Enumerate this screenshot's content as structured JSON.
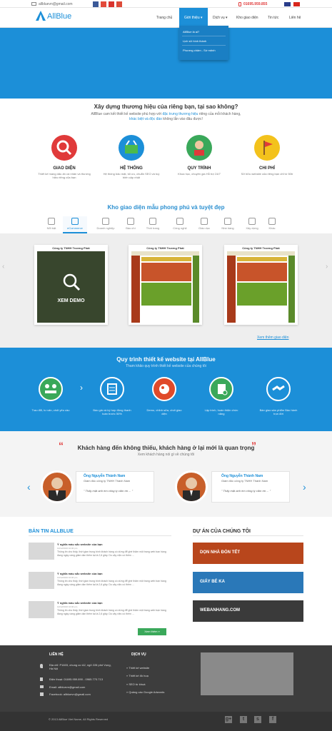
{
  "topbar": {
    "email": "allbluevn@gmail.com",
    "phone": "01695.959.855",
    "social": [
      "f",
      "t",
      "yt",
      "g+"
    ]
  },
  "nav": {
    "logo": "AllBlue",
    "items": [
      "Trang chủ",
      "Giới thiệu ▾",
      "Dịch vụ ▾",
      "Kho giao diện",
      "Tin tức",
      "Liên hệ"
    ],
    "active": 1,
    "dropdown": [
      "AllBlue là ai?",
      "Lịch sử hình thành",
      "Phương châm - Sứ mệnh"
    ]
  },
  "intro": {
    "title": "Xây dựng thương hiệu của riêng bạn, tại sao không?",
    "line1a": "AllBlue cam kết thiết kế website phù hợp với ",
    "line1b": "đặc trưng thương hiệu",
    "line1c": " riêng của mỗi khách hàng,",
    "line2a": "khác biệt và độc đáo",
    "line2b": " không lẫn vào đâu được!"
  },
  "features": [
    {
      "title": "GIAO DIỆN",
      "desc": "Thiết kế mang dấu ấn cá nhân và thương hiệu riêng của bạn",
      "color": "#e03a3a"
    },
    {
      "title": "HỆ THỐNG",
      "desc": "Hệ thống bảo mật, tối ưu, chuẩn SEO và tuỳ biến cập nhật",
      "color": "#1c8fd8"
    },
    {
      "title": "QUY TRÌNH",
      "desc": "Khoa học, chuyên gia Hỗ trợ 24/7",
      "color": "#3aa85a"
    },
    {
      "title": "CHI PHÍ",
      "desc": "Sở hữu website của riêng bạn chỉ từ 50tr",
      "color": "#f3c21c"
    }
  ],
  "gallery": {
    "title": "Kho giao diện mẫu phong phú và tuyệt đẹp",
    "tabs": [
      "Nổi bật",
      "eCommerce",
      "Doanh nghiệp",
      "Báo chí",
      "Thời trang",
      "Công nghệ",
      "Giáo dục",
      "Nhà hàng",
      "Xây dựng",
      "Khác"
    ],
    "active_tab": 1,
    "cards": [
      "Công ty TNHH Trương Phát",
      "Công ty TNHH Trương Phát",
      "Công ty TNHH Trương Phát"
    ],
    "demo_label": "XEM DEMO",
    "more": "Xem thêm giao diện"
  },
  "process": {
    "title": "Quy trình thiết kế website tại AllBlue",
    "subtitle": "Tham khảo quy trình thiết kế website của chúng tôi",
    "steps": [
      {
        "label": "Trao đổi, tư vấn, chốt yêu cầu",
        "color": "#3aa85a"
      },
      {
        "label": "Báo giá và ký hợp đồng thanh toán trước 50%",
        "color": "#1c8fd8"
      },
      {
        "label": "Demo, chỉnh sửa, chốt giao diện",
        "color": "#e04a2a"
      },
      {
        "label": "Lập trình, hoàn thiện chức năng",
        "color": "#3aa85a"
      },
      {
        "label": "Bàn giao sản phẩm Bảo hành trọn đời",
        "color": "#1c8fd8"
      }
    ]
  },
  "testimonials": {
    "title": "Khách hàng đến không thiếu, khách hàng ở lại mới là quan trọng",
    "subtitle": "Xem khách hàng nói gì về chúng tôi",
    "items": [
      {
        "name": "Ông Nguyễn Thành Nam",
        "role": "Giám đốc công ty TNHH Thành Nam",
        "quote": "\" Thấy mặt anh em công ty cảm ơn ... \""
      },
      {
        "name": "Ông Nguyễn Thành Nam",
        "role": "Giám đốc công ty TNHH Thành Nam",
        "quote": "\" Thấy mặt anh em công ty cảm ơn ... \""
      }
    ]
  },
  "news": {
    "title": "BẢN TIN ALLBLUE",
    "items": [
      {
        "title": "Ý nghĩa màu sắc website của bạn",
        "date": "12/12/2016 10:00 pm",
        "text": "Thông tin cho thấy, thời gian trung bình khách hàng có dừng để ghé thăm một trang web bạn hàng đang ngày càng giảm dần thêm tại là 2,6 giây. Do vậy việc có thêm ..."
      },
      {
        "title": "Ý nghĩa màu sắc website của bạn",
        "date": "12/12/2016 10:00 pm",
        "text": "Thông tin cho thấy, thời gian trung bình khách hàng có dừng để ghé thăm một trang web bạn hàng đang ngày càng giảm dần thêm tại là 2,6 giây. Do vậy việc có thêm ..."
      },
      {
        "title": "Ý nghĩa màu sắc website của bạn",
        "date": "12/12/2016 10:00 pm",
        "text": "Thông tin cho thấy, thời gian trung bình khách hàng có dừng để ghé thăm một trang web bạn hàng đang ngày càng giảm dần thêm tại là 2,6 giây. Do vậy việc có thêm ..."
      }
    ],
    "more": "Xem thêm »"
  },
  "projects": {
    "title": "DỰ ÁN CỦA CHÚNG TÔI",
    "items": [
      {
        "label": "DỌN NHÀ ĐÓN TẾT",
        "color": "#b8461c"
      },
      {
        "label": "GIẤY BÉ KA",
        "color": "#2a78b8"
      },
      {
        "label": "WEBANHANG.COM",
        "color": "#3a3a3a"
      }
    ]
  },
  "footer": {
    "contact_title": "LIÊN HỆ",
    "address": "Địa chỉ: P1603, chung cư A2, ngõ 228 phố Vọng, Hà Nội",
    "phone": "Điện thoại: 01695.959.890 - 0965.770.713",
    "email": "Email: allbluevn@gmail.com",
    "facebook": "Facebook: allbluevn@gmail.com",
    "service_title": "DỊCH VỤ",
    "services": [
      "» Thiết kế website",
      "» Thiết kế đồ hoạ",
      "» SEO từ khoá",
      "» Quảng cáo Google Adwords"
    ],
    "copyright": "© 2013 AllBlue Viet Name, All Rights Reserved",
    "social": [
      "g+",
      "t",
      "s",
      "f"
    ]
  }
}
